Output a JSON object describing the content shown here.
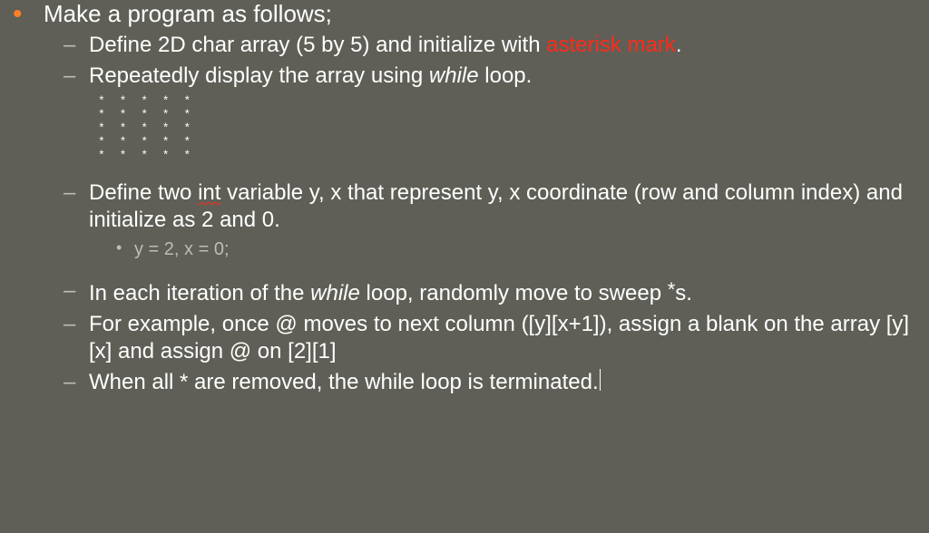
{
  "bullets": {
    "main": "Make a program as follows;",
    "b1_a": "Define 2D char array (5 by 5) and initialize with ",
    "b1_red": "asterisk mark",
    "b1_b": ".",
    "b2_a": "Repeatedly display the array using ",
    "b2_while": "while",
    "b2_b": " loop.",
    "grid": "* * * * *\n* * * * *\n* * * * *\n* * * * *\n* * * * *",
    "b3_a": "Define two ",
    "b3_int": "int",
    "b3_b": " variable y, x that represent y, x coordinate (row and column index) and initialize as 2 and 0.",
    "b3_sub": "y = 2, x = 0;",
    "b4_a": "In each iteration of the ",
    "b4_while": "while",
    "b4_b": " loop, randomly move to sweep ",
    "b4_star": "*",
    "b4_c": "s.",
    "b5": "For example, once @ moves to next column ([y][x+1]), assign a blank on the array [y][x] and assign @ on [2][1]",
    "b6": "When all * are removed, the while loop is terminated."
  }
}
